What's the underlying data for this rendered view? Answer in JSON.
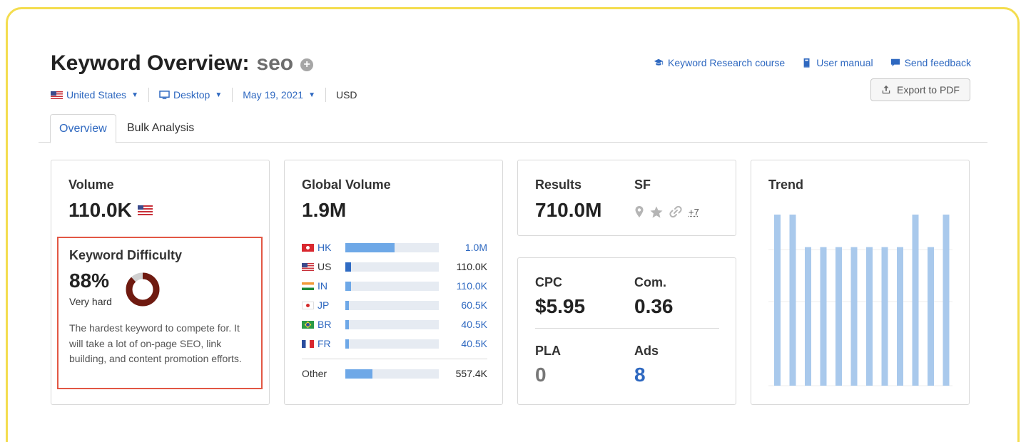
{
  "header": {
    "title_prefix": "Keyword Overview:",
    "keyword": "seo",
    "links": [
      {
        "label": "Keyword Research course",
        "icon": "graduation-cap-icon"
      },
      {
        "label": "User manual",
        "icon": "book-icon"
      },
      {
        "label": "Send feedback",
        "icon": "speech-bubble-icon"
      }
    ],
    "export_label": "Export to PDF"
  },
  "filters": {
    "country": "United States",
    "device": "Desktop",
    "date": "May 19, 2021",
    "currency": "USD"
  },
  "tabs": [
    {
      "label": "Overview",
      "active": true
    },
    {
      "label": "Bulk Analysis",
      "active": false
    }
  ],
  "volume": {
    "label": "Volume",
    "value": "110.0K"
  },
  "difficulty": {
    "label": "Keyword Difficulty",
    "value": "88%",
    "percent": 88,
    "level": "Very hard",
    "description": "The hardest keyword to compete for. It will take a lot of on-page SEO, link building, and content promotion efforts.",
    "color": "#6f1a10"
  },
  "global_volume": {
    "label": "Global Volume",
    "value": "1.9M",
    "countries": [
      {
        "code": "HK",
        "value": "1.0M",
        "share": 0.53,
        "link": true
      },
      {
        "code": "US",
        "value": "110.0K",
        "share": 0.06,
        "link": false
      },
      {
        "code": "IN",
        "value": "110.0K",
        "share": 0.06,
        "link": true
      },
      {
        "code": "JP",
        "value": "60.5K",
        "share": 0.03,
        "link": true
      },
      {
        "code": "BR",
        "value": "40.5K",
        "share": 0.02,
        "link": true
      },
      {
        "code": "FR",
        "value": "40.5K",
        "share": 0.02,
        "link": true
      }
    ],
    "other": {
      "label": "Other",
      "value": "557.4K",
      "share": 0.29
    }
  },
  "results": {
    "label": "Results",
    "value": "710.0M",
    "sf_label": "SF",
    "sf_more": "+7"
  },
  "cpc": {
    "cpc_label": "CPC",
    "cpc_value": "$5.95",
    "com_label": "Com.",
    "com_value": "0.36",
    "pla_label": "PLA",
    "pla_value": "0",
    "ads_label": "Ads",
    "ads_value": "8"
  },
  "trend": {
    "label": "Trend",
    "bar_color": "#a9c9ec",
    "values": [
      1.0,
      1.0,
      0.81,
      0.81,
      0.81,
      0.81,
      0.81,
      0.81,
      0.81,
      1.0,
      0.81,
      1.0
    ]
  },
  "colors": {
    "link": "#2e68c0",
    "highlight_border": "#e25744",
    "frame": "#f4dd4f"
  }
}
